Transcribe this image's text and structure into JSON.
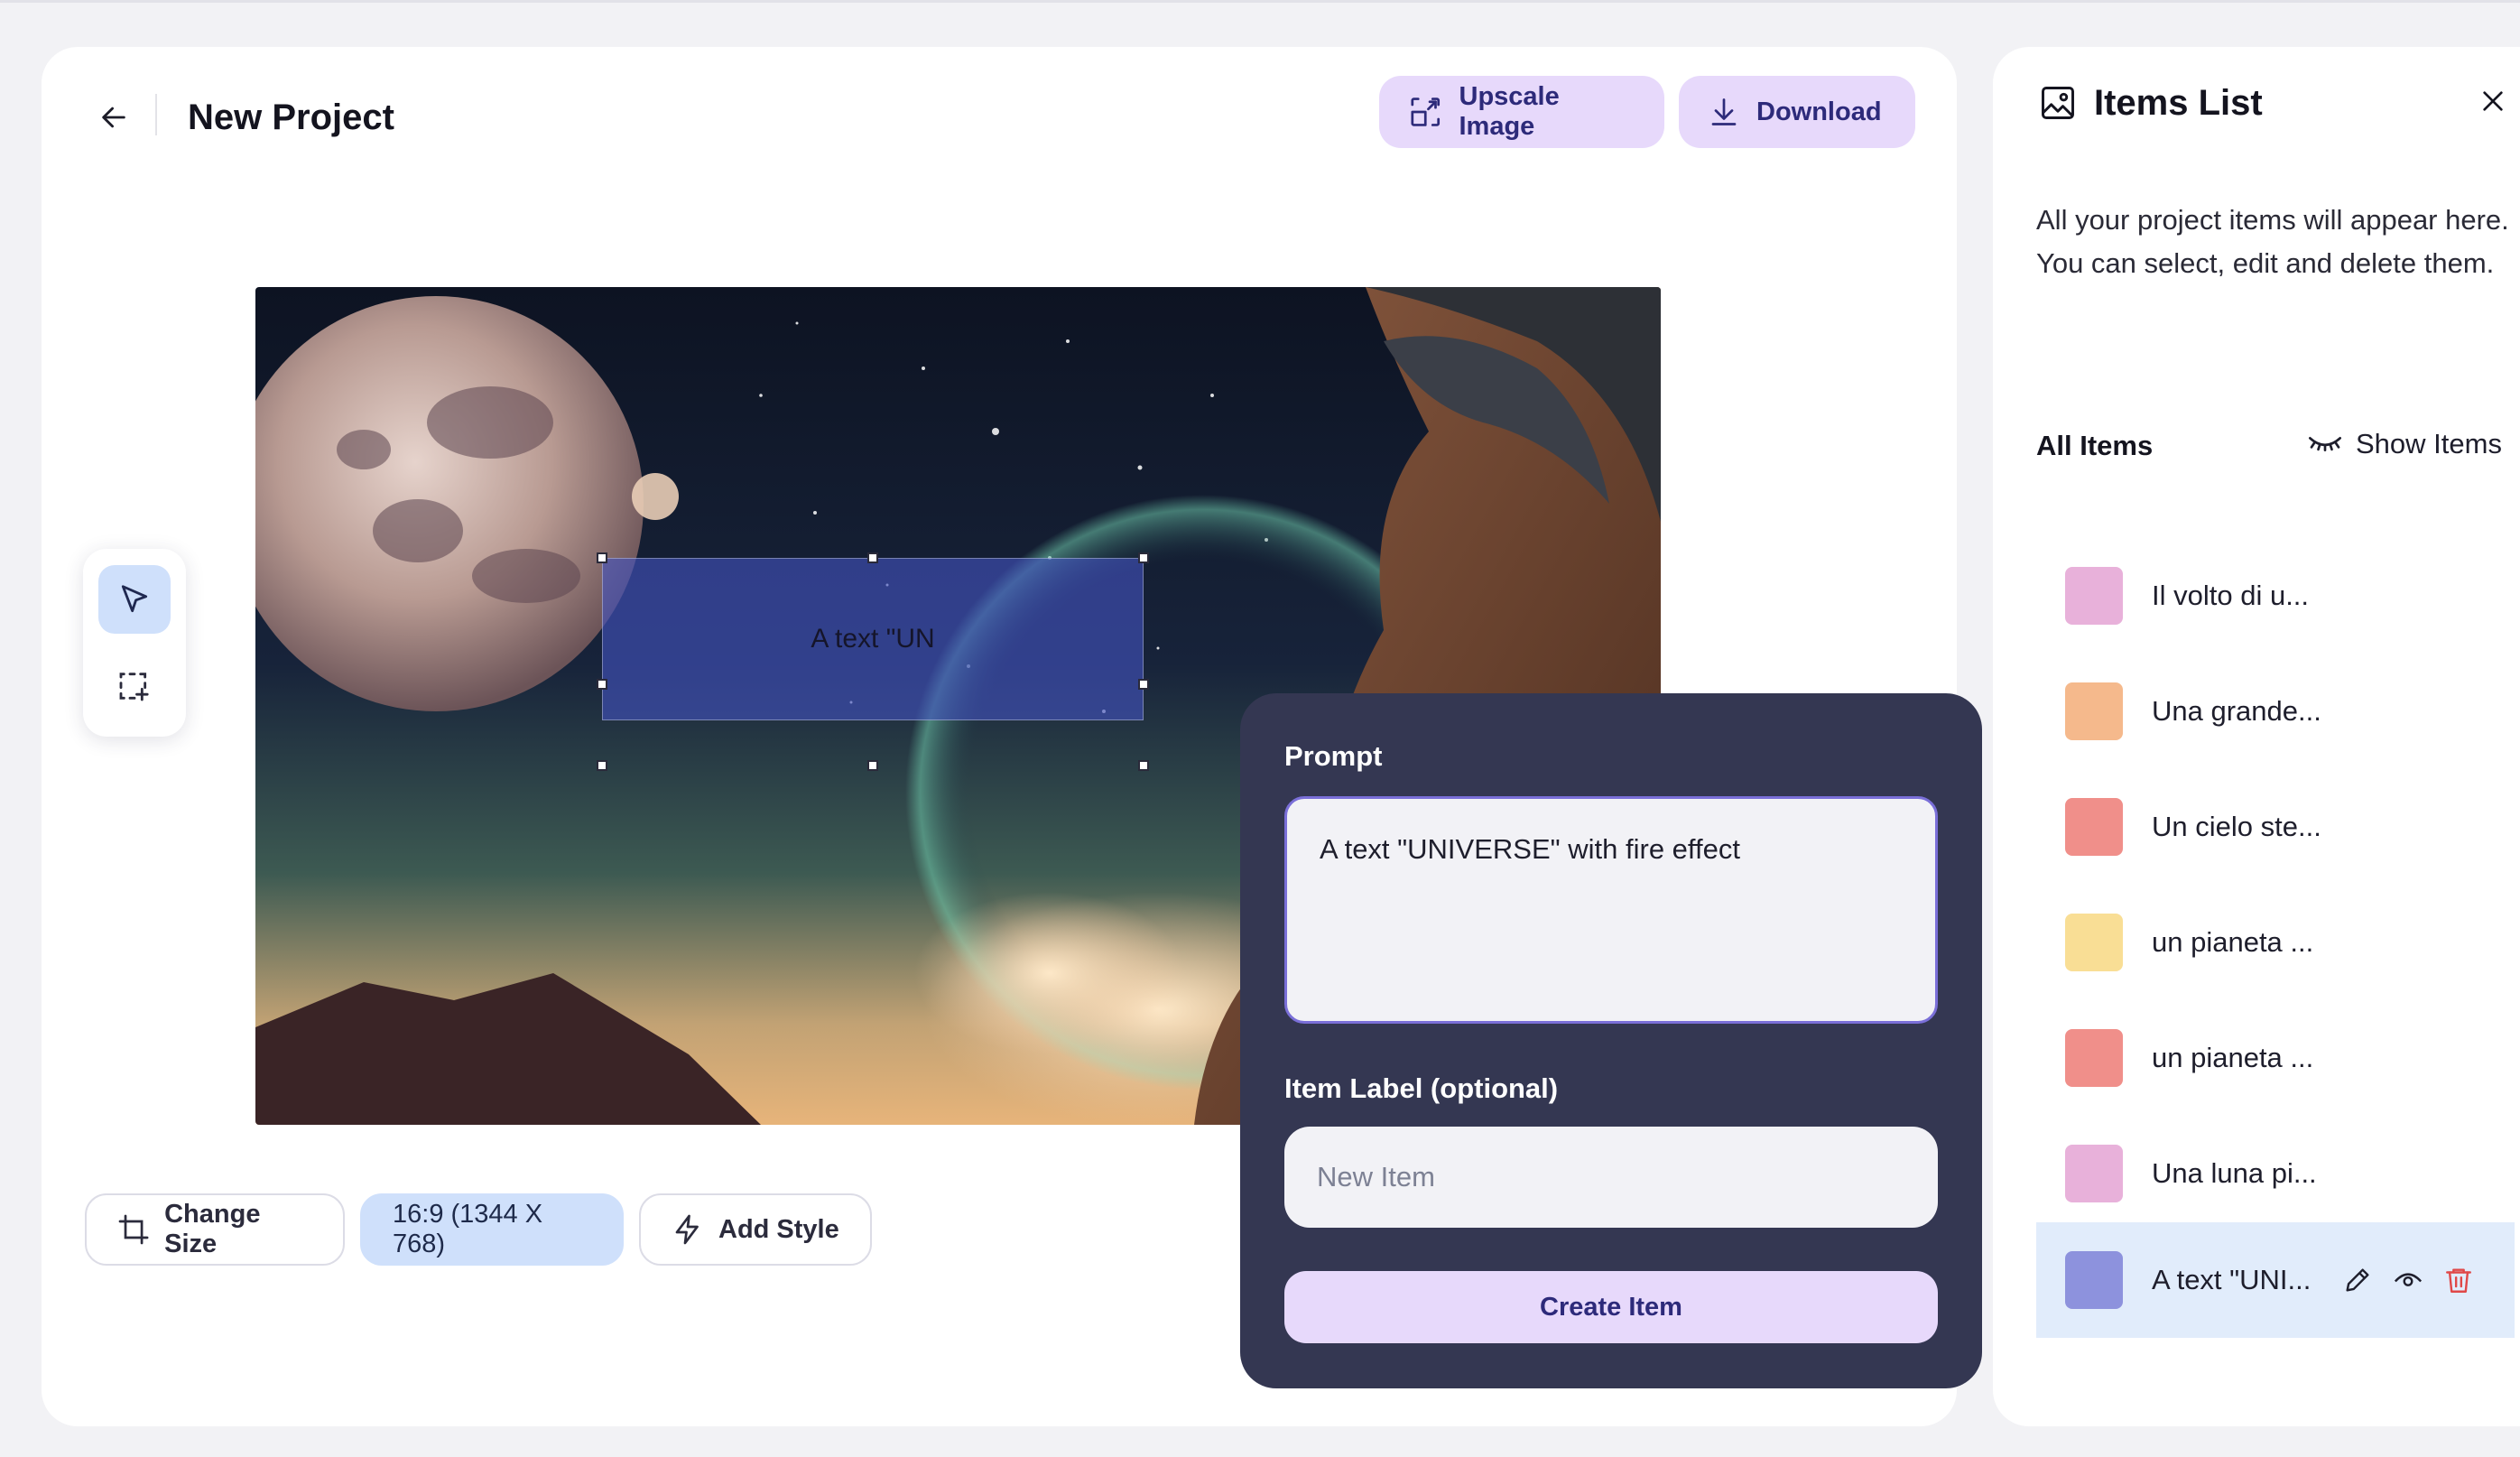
{
  "header": {
    "title": "New Project",
    "upscale_label": "Upscale Image",
    "download_label": "Download"
  },
  "canvas": {
    "selection_text": "A text \"UN"
  },
  "bottom_bar": {
    "change_size_label": "Change Size",
    "ratio_label": "16:9 (1344 X 768)",
    "add_style_label": "Add Style"
  },
  "prompt_panel": {
    "prompt_label": "Prompt",
    "prompt_value": "A text \"UNIVERSE\" with fire effect",
    "item_label_label": "Item Label (optional)",
    "item_label_placeholder": "New Item",
    "create_label": "Create Item"
  },
  "sidebar": {
    "title": "Items List",
    "description": "All your project items will appear here. You can select, edit and delete them.",
    "all_items_label": "All Items",
    "show_items_label": "Show Items",
    "items": [
      {
        "label": "Il volto di u...",
        "color": "#e8b1da"
      },
      {
        "label": "Una grande...",
        "color": "#f5b98c"
      },
      {
        "label": "Un cielo ste...",
        "color": "#f08f8a"
      },
      {
        "label": "un pianeta ...",
        "color": "#f9de95"
      },
      {
        "label": "un pianeta ...",
        "color": "#f08f8a"
      },
      {
        "label": "Una luna pi...",
        "color": "#e8b1da"
      },
      {
        "label": "A text \"UNI...",
        "color": "#8d92dd"
      }
    ]
  },
  "colors": {
    "accent_purple": "#e7d9fb",
    "accent_blue": "#cfe0fb",
    "panel_dark": "#343752",
    "delete_red": "#e04848"
  }
}
